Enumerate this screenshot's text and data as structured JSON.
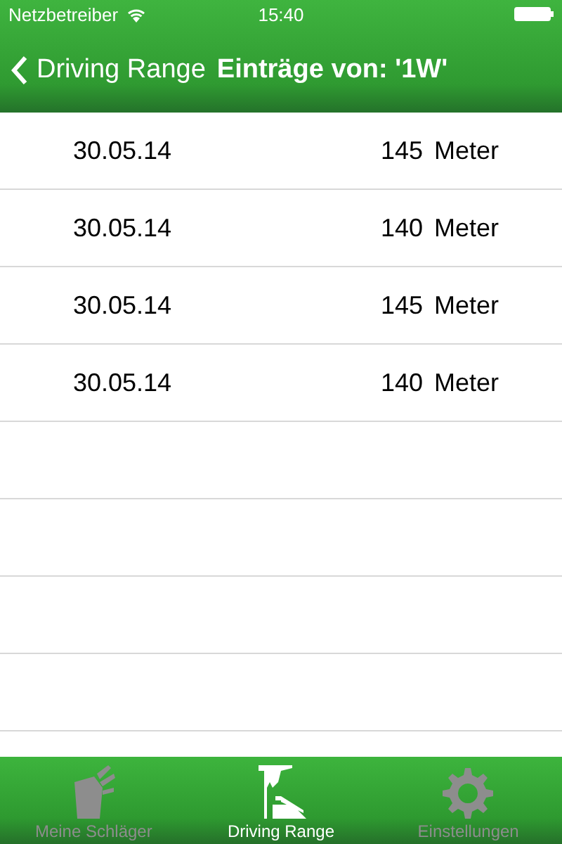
{
  "status_bar": {
    "carrier": "Netzbetreiber",
    "time": "15:40"
  },
  "nav": {
    "back": "Driving Range",
    "title": "Einträge von: '1W'"
  },
  "entries": [
    {
      "date": "30.05.14",
      "distance": "145",
      "unit": "Meter"
    },
    {
      "date": "30.05.14",
      "distance": "140",
      "unit": "Meter"
    },
    {
      "date": "30.05.14",
      "distance": "145",
      "unit": "Meter"
    },
    {
      "date": "30.05.14",
      "distance": "140",
      "unit": "Meter"
    }
  ],
  "tabs": [
    {
      "label": "Meine Schläger",
      "kind": "bag",
      "selected": false
    },
    {
      "label": "Driving Range",
      "kind": "range",
      "selected": true
    },
    {
      "label": "Einstellungen",
      "kind": "gear",
      "selected": false
    }
  ]
}
